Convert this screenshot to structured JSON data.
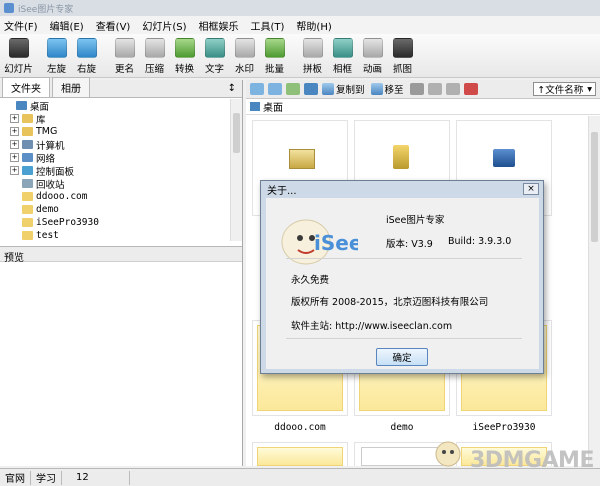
{
  "window": {
    "title": "iSee图片专家"
  },
  "menu": [
    "文件(F)",
    "编辑(E)",
    "查看(V)",
    "幻灯片(S)",
    "相框娱乐",
    "工具(T)",
    "帮助(H)"
  ],
  "toolbar": [
    {
      "label": "幻灯片",
      "icon": "slideshow-icon",
      "color": "dark"
    },
    {
      "label": "左旋",
      "icon": "rotate-left-icon",
      "color": "blue"
    },
    {
      "label": "右旋",
      "icon": "rotate-right-icon",
      "color": "blue"
    },
    {
      "label": "更名",
      "icon": "rename-icon",
      "color": "gray"
    },
    {
      "label": "压缩",
      "icon": "compress-icon",
      "color": "gray"
    },
    {
      "label": "转换",
      "icon": "convert-icon",
      "color": "green"
    },
    {
      "label": "文字",
      "icon": "text-icon",
      "color": "teal"
    },
    {
      "label": "水印",
      "icon": "watermark-icon",
      "color": "gray"
    },
    {
      "label": "批量",
      "icon": "batch-icon",
      "color": "green"
    },
    {
      "label": "拼板",
      "icon": "collage-icon",
      "color": "gray"
    },
    {
      "label": "相框",
      "icon": "frame-icon",
      "color": "teal"
    },
    {
      "label": "动画",
      "icon": "animation-icon",
      "color": "gray"
    },
    {
      "label": "抓图",
      "icon": "capture-icon",
      "color": "dark"
    }
  ],
  "left_tabs": [
    "文件夹",
    "相册"
  ],
  "tree": [
    {
      "label": "桌面",
      "expand": "",
      "level": 0,
      "color": "#4a86c0"
    },
    {
      "label": "库",
      "expand": "+",
      "level": 1,
      "color": "#e8c25a"
    },
    {
      "label": "TMG",
      "expand": "+",
      "level": 1,
      "color": "#e8c25a"
    },
    {
      "label": "计算机",
      "expand": "+",
      "level": 1,
      "color": "#6f8fb0"
    },
    {
      "label": "网络",
      "expand": "+",
      "level": 1,
      "color": "#5d8fc7"
    },
    {
      "label": "控制面板",
      "expand": "+",
      "level": 1,
      "color": "#4aa0d0"
    },
    {
      "label": "回收站",
      "expand": "",
      "level": 1,
      "color": "#8aa4b8"
    },
    {
      "label": "ddooo.com",
      "expand": "",
      "level": 1,
      "color": "#f0d06a"
    },
    {
      "label": "demo",
      "expand": "",
      "level": 1,
      "color": "#f0d06a"
    },
    {
      "label": "iSeePro3930",
      "expand": "",
      "level": 1,
      "color": "#f0d06a"
    },
    {
      "label": "test",
      "expand": "",
      "level": 1,
      "color": "#f0d06a"
    }
  ],
  "preview_label": "预览",
  "right_toolbar": {
    "copy_to": "复制到",
    "move_to": "移至",
    "sort": "↑文件名称"
  },
  "path": "桌面",
  "thumb_labels": [
    "ddooo.com",
    "demo",
    "iSeePro3930"
  ],
  "dialog": {
    "title": "关于...",
    "close": "×",
    "product": "iSee图片专家",
    "version_label": "版本: V3.9",
    "build_label": "Build: 3.9.3.0",
    "license": "永久免费",
    "copyright": "版权所有 2008-2015，北京迈图科技有限公司",
    "site": "软件主站: http://www.iseeclan.com",
    "ok": "确定",
    "mascot_text": "iSee"
  },
  "status": [
    "官网",
    "学习",
    "12"
  ],
  "watermark": "3DMGAME"
}
